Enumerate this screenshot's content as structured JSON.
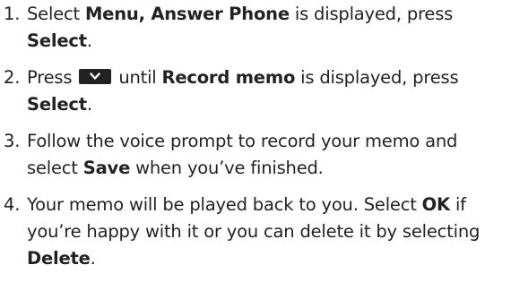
{
  "steps": [
    {
      "number": "1.",
      "t1": "Select ",
      "b1": "Menu, Answer Phone",
      "t2": " is displayed, press ",
      "b2": "Select",
      "t3": "."
    },
    {
      "number": "2.",
      "t1": "Press ",
      "icon": "chevron-down-key-icon",
      "t2": " until ",
      "b1": "Record memo",
      "t3": " is displayed, press ",
      "b2": "Select",
      "t4": "."
    },
    {
      "number": "3.",
      "t1": "Follow the voice prompt to record your memo and select ",
      "b1": "Save",
      "t2": " when you’ve finished."
    },
    {
      "number": "4.",
      "t1": "Your memo will be played back to you. Select ",
      "b1": "OK",
      "t2": " if you’re happy with it or you can delete it by selecting ",
      "b2": "Delete",
      "t3": "."
    }
  ]
}
